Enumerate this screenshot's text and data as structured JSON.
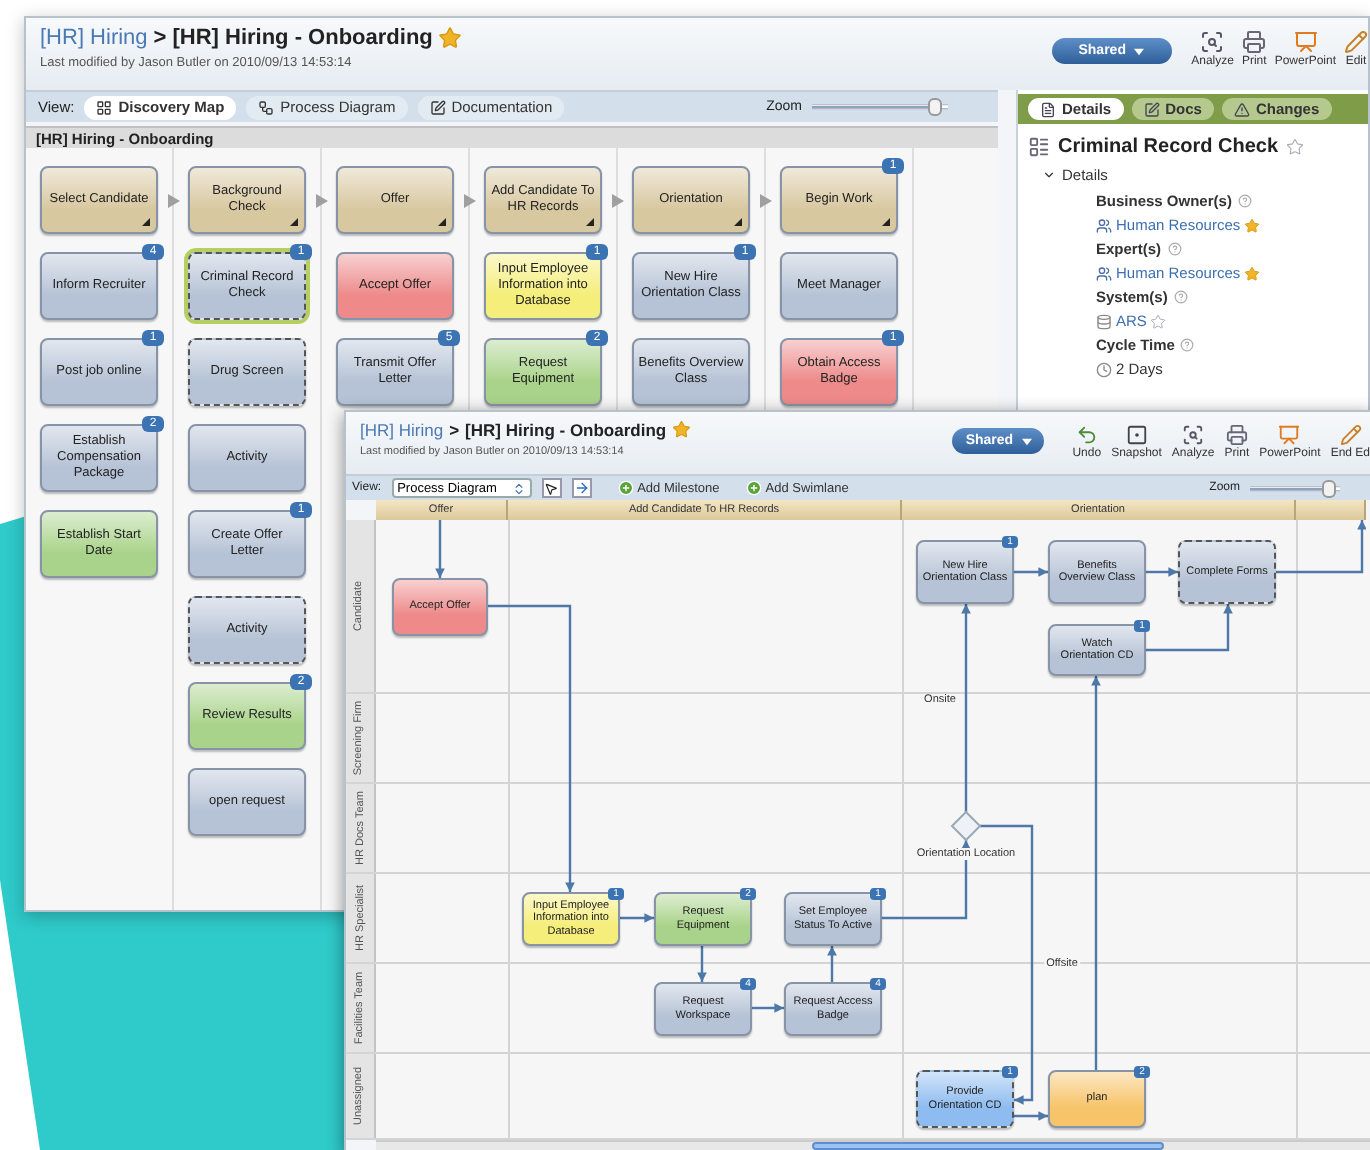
{
  "back_window": {
    "breadcrumb": {
      "parent": "[HR] Hiring",
      "separator": ">",
      "current": "[HR] Hiring - Onboarding",
      "starred": true
    },
    "last_modified": "Last modified by Jason Butler on 2010/09/13 14:53:14",
    "shared_button": "Shared",
    "toolbar": [
      "Analyze",
      "Print",
      "PowerPoint",
      "Edit"
    ],
    "view_label": "View:",
    "view_tabs": [
      {
        "label": "Discovery Map",
        "selected": true
      },
      {
        "label": "Process Diagram",
        "selected": false
      },
      {
        "label": "Documentation",
        "selected": false
      }
    ],
    "zoom": {
      "label": "Zoom",
      "level": 0.95
    },
    "map_title": "[HR] Hiring - Onboarding",
    "columns": [
      {
        "cards": [
          {
            "label": "Select Candidate",
            "kind": "milestone",
            "color": "#d8c8a0",
            "dashed": false,
            "selected": false
          },
          {
            "label": "Inform Recruiter",
            "kind": "activity",
            "color": "#b6c3d6",
            "comments": "4",
            "dashed": false,
            "selected": false
          },
          {
            "label": "Post job online",
            "kind": "activity",
            "color": "#b6c3d6",
            "comments": "1",
            "dashed": false,
            "selected": false
          },
          {
            "label": "Establish Compensation Package",
            "kind": "activity",
            "color": "#b6c3d6",
            "comments": "2",
            "dashed": false,
            "selected": false
          },
          {
            "label": "Establish Start Date",
            "kind": "activity",
            "color": "#a9d38a",
            "dashed": false,
            "selected": false
          }
        ]
      },
      {
        "cards": [
          {
            "label": "Background Check",
            "kind": "milestone",
            "color": "#d8c8a0",
            "dashed": false,
            "selected": false
          },
          {
            "label": "Criminal Record Check",
            "kind": "activity",
            "color": "#b6c3d6",
            "comments": "1",
            "dashed": true,
            "selected": true
          },
          {
            "label": "Drug Screen",
            "kind": "activity",
            "color": "#b6c3d6",
            "dashed": true,
            "selected": false
          },
          {
            "label": "Activity",
            "kind": "activity",
            "color": "#b6c3d6",
            "dashed": false,
            "selected": false
          },
          {
            "label": "Create Offer Letter",
            "kind": "activity",
            "color": "#b6c3d6",
            "comments": "1",
            "dashed": false,
            "selected": false
          },
          {
            "label": "Activity",
            "kind": "activity",
            "color": "#b6c3d6",
            "dashed": true,
            "selected": false
          },
          {
            "label": "Review Results",
            "kind": "activity",
            "color": "#a9d38a",
            "comments": "2",
            "dashed": false,
            "selected": false
          },
          {
            "label": "open request",
            "kind": "activity",
            "color": "#b6c3d6",
            "dashed": false,
            "selected": false
          }
        ]
      },
      {
        "cards": [
          {
            "label": "Offer",
            "kind": "milestone",
            "color": "#d8c8a0",
            "dashed": false,
            "selected": false
          },
          {
            "label": "Accept Offer",
            "kind": "activity",
            "color": "#ee8a8a",
            "dashed": false,
            "selected": false
          },
          {
            "label": "Transmit Offer Letter",
            "kind": "activity",
            "color": "#b6c3d6",
            "comments": "5",
            "dashed": false,
            "selected": false
          }
        ]
      },
      {
        "cards": [
          {
            "label": "Add Candidate To HR Records",
            "kind": "milestone",
            "color": "#d8c8a0",
            "dashed": false,
            "selected": false
          },
          {
            "label": "Input Employee Information into Database",
            "kind": "activity",
            "color": "#f5ee7a",
            "comments": "1",
            "dashed": false,
            "selected": false
          },
          {
            "label": "Request Equipment",
            "kind": "activity",
            "color": "#a9d38a",
            "comments": "2",
            "dashed": false,
            "selected": false
          }
        ]
      },
      {
        "cards": [
          {
            "label": "Orientation",
            "kind": "milestone",
            "color": "#d8c8a0",
            "dashed": false,
            "selected": false
          },
          {
            "label": "New Hire Orientation Class",
            "kind": "activity",
            "color": "#b6c3d6",
            "comments": "1",
            "dashed": false,
            "selected": false
          },
          {
            "label": "Benefits Overview Class",
            "kind": "activity",
            "color": "#b6c3d6",
            "dashed": false,
            "selected": false
          }
        ]
      },
      {
        "cards": [
          {
            "label": "Begin Work",
            "kind": "milestone",
            "color": "#d8c8a0",
            "comments": "1",
            "dashed": false,
            "selected": false
          },
          {
            "label": "Meet Manager",
            "kind": "activity",
            "color": "#b6c3d6",
            "dashed": false,
            "selected": false
          },
          {
            "label": "Obtain Access Badge",
            "kind": "activity",
            "color": "#ee8a8a",
            "comments": "1",
            "dashed": false,
            "selected": false
          }
        ]
      }
    ],
    "details_panel": {
      "tabs": [
        {
          "label": "Details",
          "selected": true
        },
        {
          "label": "Docs",
          "selected": false
        },
        {
          "label": "Changes",
          "selected": false
        }
      ],
      "title": "Criminal Record Check",
      "starred": false,
      "section": "Details",
      "expanded": true,
      "fields": [
        {
          "label": "Business Owner(s)",
          "kind": "group",
          "value": "Human Resources",
          "starred": true
        },
        {
          "label": "Expert(s)",
          "kind": "group",
          "value": "Human Resources",
          "starred": true
        },
        {
          "label": "System(s)",
          "kind": "system",
          "value": "ARS",
          "starred": false
        },
        {
          "label": "Cycle Time",
          "kind": "duration",
          "value": "2 Days"
        }
      ]
    }
  },
  "front_window": {
    "breadcrumb": {
      "parent": "[HR] Hiring",
      "separator": ">",
      "current": "[HR] Hiring - Onboarding",
      "starred": true
    },
    "last_modified": "Last modified by Jason Butler on 2010/09/13 14:53:14",
    "shared_button": "Shared",
    "toolbar": [
      "Undo",
      "Snapshot",
      "Analyze",
      "Print",
      "PowerPoint",
      "End Ed"
    ],
    "view_label": "View:",
    "view_select": "Process Diagram",
    "actions": [
      "Add Milestone",
      "Add Swimlane"
    ],
    "zoom": {
      "label": "Zoom",
      "level": 0.95
    },
    "milestones": [
      "Offer",
      "Add Candidate To HR Records",
      "Orientation"
    ],
    "lanes": [
      "Candidate",
      "Screening Firm",
      "HR Docs Team",
      "HR Specialist",
      "Facilities Team",
      "Unassigned"
    ],
    "nodes": [
      {
        "label": "Accept Offer",
        "color": "#ee8a8a",
        "dashed": false
      },
      {
        "label": "New Hire Orientation Class",
        "color": "#b6c3d6",
        "comments": "1",
        "dashed": false
      },
      {
        "label": "Benefits Overview Class",
        "color": "#b6c3d6",
        "dashed": false
      },
      {
        "label": "Complete Forms",
        "color": "#b6c3d6",
        "dashed": true
      },
      {
        "label": "Watch Orientation CD",
        "color": "#b6c3d6",
        "comments": "1",
        "dashed": false
      },
      {
        "label": "Input Employee Information into Database",
        "color": "#f5ee7a",
        "comments": "1",
        "dashed": false
      },
      {
        "label": "Request Equipment",
        "color": "#a9d38a",
        "comments": "2",
        "dashed": false
      },
      {
        "label": "Set Employee Status To Active",
        "color": "#b6c3d6",
        "comments": "1",
        "dashed": false
      },
      {
        "label": "Request Workspace",
        "color": "#b6c3d6",
        "comments": "4",
        "dashed": false
      },
      {
        "label": "Request Access Badge",
        "color": "#b6c3d6",
        "comments": "4",
        "dashed": false
      },
      {
        "label": "Provide Orientation CD",
        "color": "#8fbcf0",
        "comments": "1",
        "dashed": true
      },
      {
        "label": "plan",
        "color": "#f7c46a",
        "comments": "2",
        "dashed": false
      }
    ],
    "decision": {
      "label": "Orientation Location"
    },
    "branch_labels": [
      "Onsite",
      "Offsite"
    ]
  }
}
